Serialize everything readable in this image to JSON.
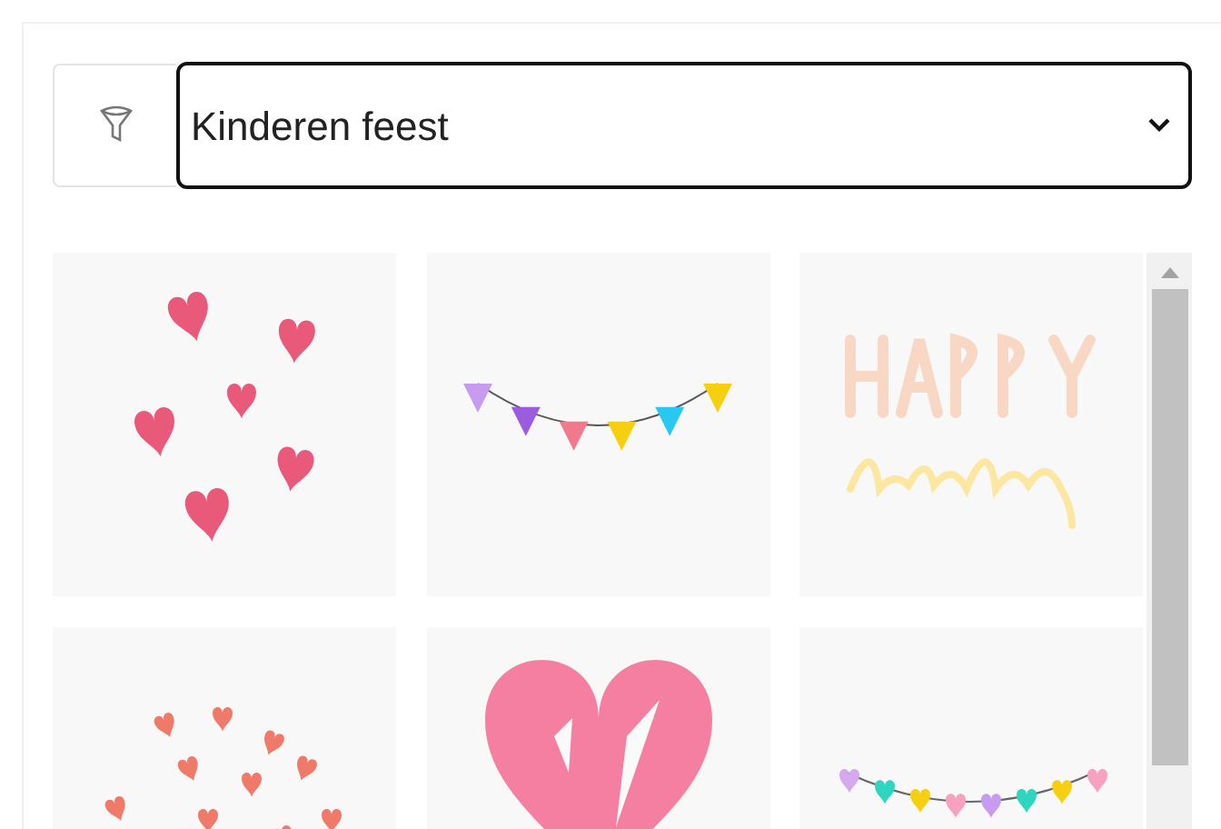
{
  "filter": {
    "value": "Kinderen feest"
  },
  "stickers": [
    {
      "kind": "hearts"
    },
    {
      "kind": "bunting"
    },
    {
      "kind": "birthday"
    },
    {
      "kind": "small-hearts"
    },
    {
      "kind": "big-heart"
    },
    {
      "kind": "heart-garland"
    }
  ]
}
